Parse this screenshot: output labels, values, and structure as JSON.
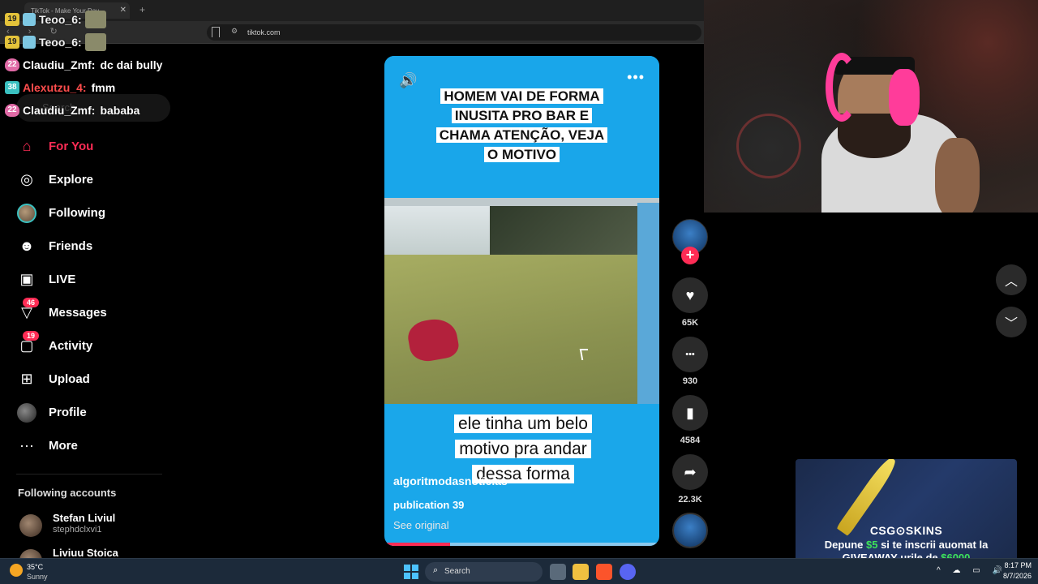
{
  "browser": {
    "tab_title": "TikTok - Make Your Day",
    "tab_close": "✕",
    "new_tab": "+",
    "nav_buttons": "‹ › ↻",
    "url": "tiktok.com"
  },
  "chat": [
    {
      "badge": "19",
      "user": "Teoo_6:",
      "message": ""
    },
    {
      "badge": "19",
      "user": "Teoo_6:",
      "message": ""
    },
    {
      "badge": "22",
      "user": "Claudiu_Zmf:",
      "message": "dc dai bully"
    },
    {
      "badge": "38",
      "user": "Alexutzu_4:",
      "message": "fmm"
    },
    {
      "badge": "22",
      "user": "Claudiu_Zmf:",
      "message": "bababa"
    }
  ],
  "search": {
    "placeholder": "Search"
  },
  "sidebar": {
    "items": [
      {
        "label": "For You",
        "icon": "⌂"
      },
      {
        "label": "Explore",
        "icon": "◎"
      },
      {
        "label": "Following",
        "icon": ""
      },
      {
        "label": "Friends",
        "icon": "☻"
      },
      {
        "label": "LIVE",
        "icon": "▣"
      },
      {
        "label": "Messages",
        "icon": "▽",
        "count": "46"
      },
      {
        "label": "Activity",
        "icon": "▢",
        "count": "19"
      },
      {
        "label": "Upload",
        "icon": "⊞"
      },
      {
        "label": "Profile",
        "icon": ""
      },
      {
        "label": "More",
        "icon": "···"
      }
    ],
    "following_title": "Following accounts",
    "accounts": [
      {
        "name": "Stefan Liviul",
        "handle": "stephdclxvi1"
      },
      {
        "name": "Liviuu Stoica",
        "handle": ""
      }
    ]
  },
  "video": {
    "sound_icon": "🔊",
    "more_icon": "•••",
    "headline": "HOMEM VAI DE FORMA INUSITA PRO BAR E CHAMA ATENÇÃO, VEJA O MOTIVO",
    "caption": "ele tinha um belo motivo pra andar dessa forma",
    "author": "algoritmodasnoticias",
    "description": "publication 39",
    "see_original": "See original",
    "progress": 0.24
  },
  "actions": {
    "follow": "+",
    "like_icon": "♥",
    "likes": "65K",
    "comment_icon": "•••",
    "comments": "930",
    "save_icon": "▮",
    "saves": "4584",
    "share_icon": "➦",
    "shares": "22.3K"
  },
  "nav_arrows": {
    "up": "︿",
    "down": "﹀"
  },
  "ad": {
    "brand": "CSG⊙SKINS",
    "line1_a": "Depune ",
    "line1_b": "$5",
    "line1_c": " si te inscrii auomat la",
    "line2_a": "GIVEAWAY-urile de ",
    "line2_b": "$6000"
  },
  "taskbar": {
    "temperature": "35°C",
    "weather": "Sunny",
    "search": "Search",
    "search_icon": "⌕",
    "tray": "^ ☁ ▭ 🔊",
    "time": "8:17 PM",
    "date": "8/7/2026"
  },
  "colors": {
    "accent": "#fe2c55",
    "video_bg": "#1aa7ea",
    "taskbar": "#1c2a3a"
  }
}
